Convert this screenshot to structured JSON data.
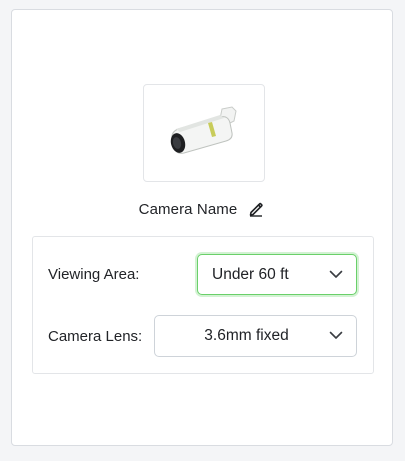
{
  "camera": {
    "name": "Camera Name",
    "image_icon": "bullet-security-camera-icon",
    "edit_icon": "pencil-edit-icon"
  },
  "settings": {
    "viewing_area": {
      "label": "Viewing Area:",
      "value": "Under 60 ft"
    },
    "camera_lens": {
      "label": "Camera Lens:",
      "value": "3.6mm fixed"
    }
  },
  "colors": {
    "focus_border": "#6ad06a",
    "text": "#222428",
    "border": "#ced3d9"
  }
}
